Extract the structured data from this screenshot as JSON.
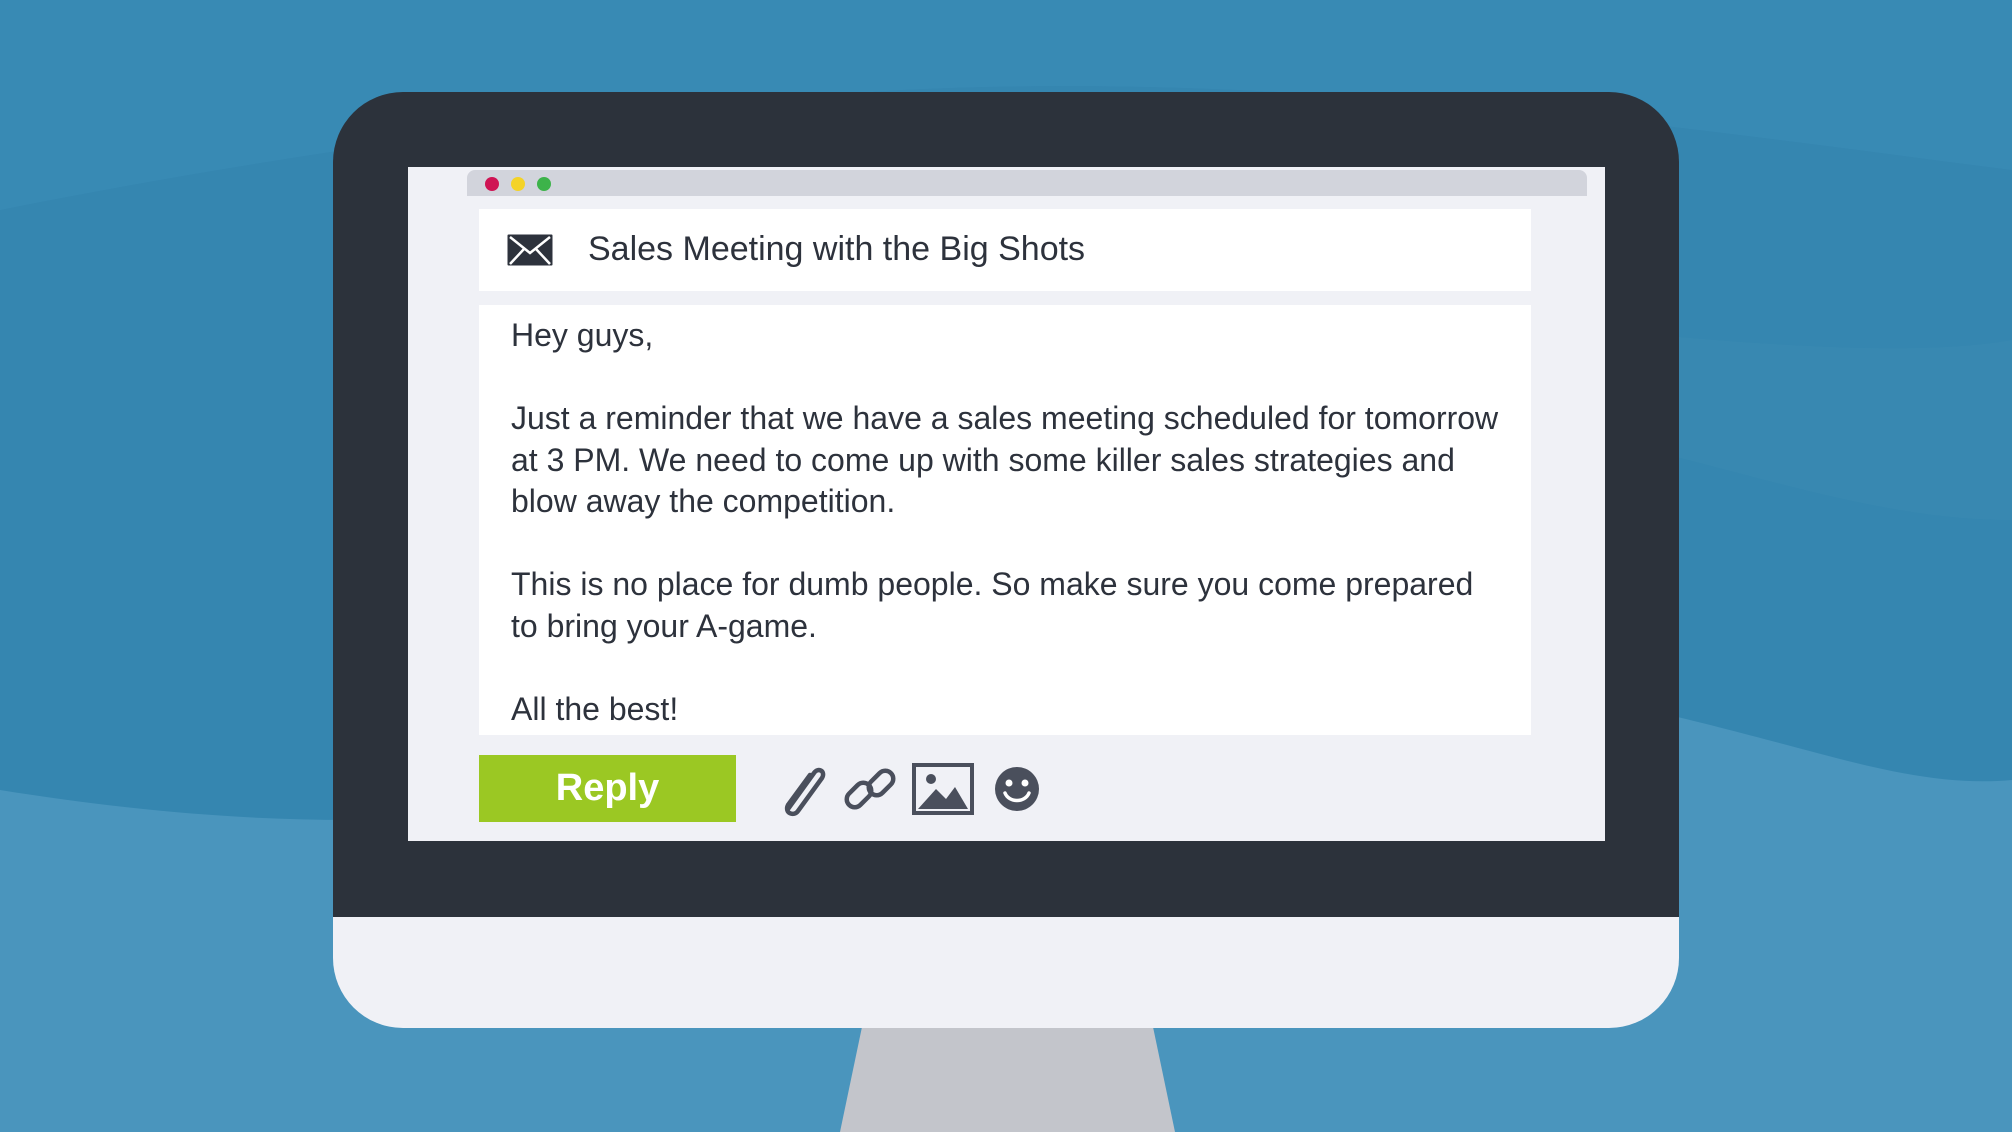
{
  "colors": {
    "background": "#3586b0",
    "bezel": "#2c323b",
    "reply_button": "#9bc823",
    "icon": "#4a4f5c"
  },
  "window": {
    "controls": [
      "close",
      "minimize",
      "maximize"
    ]
  },
  "email": {
    "subject_icon": "envelope-icon",
    "subject": "Sales Meeting with the Big Shots",
    "greeting": "Hey guys,",
    "paragraph_1": "Just a reminder that we have a sales meeting scheduled for tomorrow at 3 PM. We need to come up with some killer sales strategies and blow away the competition.",
    "paragraph_2": "This is no place for dumb people. So make sure you come prepared to bring your A-game.",
    "signoff": "All the best!"
  },
  "toolbar": {
    "reply_label": "Reply",
    "icons": [
      "paperclip-icon",
      "link-icon",
      "image-icon",
      "emoji-icon"
    ]
  }
}
